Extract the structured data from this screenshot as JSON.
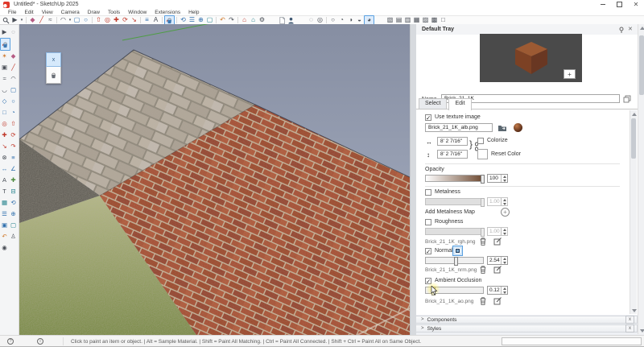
{
  "window": {
    "title": "Untitled* - SketchUp 2025"
  },
  "menu": {
    "items": [
      "File",
      "Edit",
      "View",
      "Camera",
      "Draw",
      "Tools",
      "Window",
      "Extensions",
      "Help"
    ]
  },
  "toolbar": {
    "main": [
      {
        "n": "search",
        "svg": "search"
      },
      {
        "n": "select",
        "g": "▶",
        "c": "c-dark"
      },
      {
        "n": "select-caret",
        "g": "▾",
        "c": "c-dark",
        "narrow": true
      },
      {
        "sep": true
      },
      {
        "n": "eraser",
        "g": "◆",
        "c": "c-pink"
      },
      {
        "n": "line",
        "g": "╱",
        "c": "c-red"
      },
      {
        "n": "freehand",
        "g": "≈",
        "c": "c-dark"
      },
      {
        "sep": true
      },
      {
        "n": "arc",
        "g": "◠",
        "c": "c-dark"
      },
      {
        "n": "arc-caret",
        "g": "▾",
        "c": "c-dark",
        "narrow": true
      },
      {
        "n": "rectangle",
        "g": "▢",
        "c": "c-blue"
      },
      {
        "n": "circle",
        "g": "○",
        "c": "c-blue"
      },
      {
        "sep": true
      },
      {
        "n": "push-pull",
        "g": "⇧",
        "c": "c-red"
      },
      {
        "n": "offset",
        "g": "◎",
        "c": "c-red"
      },
      {
        "n": "move",
        "g": "✚",
        "c": "c-red"
      },
      {
        "n": "rotate",
        "g": "⟳",
        "c": "c-red"
      },
      {
        "n": "scale",
        "g": "↘",
        "c": "c-red"
      },
      {
        "sep": true
      },
      {
        "n": "tape-measure",
        "g": "≡",
        "c": "c-blue"
      },
      {
        "n": "text",
        "g": "A",
        "c": "c-dark"
      },
      {
        "sep": true
      },
      {
        "n": "paint",
        "svg": "bucket",
        "sel": true
      },
      {
        "sep": true
      },
      {
        "n": "orbit",
        "g": "⟲",
        "c": "c-blue"
      },
      {
        "n": "pan",
        "g": "☰",
        "c": "c-blue"
      },
      {
        "n": "zoom",
        "g": "⊕",
        "c": "c-blue"
      },
      {
        "n": "zoom-extents",
        "g": "▢",
        "c": "c-teal"
      },
      {
        "sep": true
      },
      {
        "n": "undo",
        "g": "↶",
        "c": "c-orange"
      },
      {
        "n": "redo",
        "g": "↷",
        "c": "c-dark"
      },
      {
        "sep": true
      },
      {
        "n": "3d-warehouse",
        "g": "⌂",
        "c": "c-red"
      },
      {
        "n": "extension-warehouse",
        "g": "⌂",
        "c": "c-teal"
      },
      {
        "n": "extension-manager",
        "g": "⚙",
        "c": "c-dark"
      },
      {
        "gap": true
      },
      {
        "n": "new-document",
        "svg": "doc"
      },
      {
        "n": "sign-in",
        "svg": "person"
      },
      {
        "gap": true
      },
      {
        "n": "x-ray",
        "g": "◌",
        "c": "c-dark"
      },
      {
        "n": "back-edges",
        "g": "◎",
        "c": "c-dark"
      },
      {
        "sep": true
      },
      {
        "n": "wireframe",
        "g": "○",
        "c": "c-dark"
      },
      {
        "n": "hidden-line",
        "g": "◔",
        "c": "c-dark"
      },
      {
        "n": "shaded",
        "g": "◑",
        "c": "c-dark"
      },
      {
        "n": "monochrome",
        "g": "◒",
        "c": "c-dark"
      },
      {
        "n": "shaded-with-textures",
        "g": "◕",
        "c": "c-dark",
        "sel": true
      },
      {
        "gap": true
      },
      {
        "n": "iso-view",
        "g": "▧",
        "c": "c-dark"
      },
      {
        "n": "top-view",
        "g": "▤",
        "c": "c-dark"
      },
      {
        "n": "front-view",
        "g": "▥",
        "c": "c-dark"
      },
      {
        "n": "right-view",
        "g": "▦",
        "c": "c-dark"
      },
      {
        "n": "back-view",
        "g": "▨",
        "c": "c-dark"
      },
      {
        "n": "left-view",
        "g": "▩",
        "c": "c-dark"
      },
      {
        "n": "bottom-view",
        "g": "□",
        "c": "c-dark"
      }
    ]
  },
  "palette": {
    "items": [
      {
        "n": "select",
        "g": "▶",
        "c": "c-dark"
      },
      {
        "n": "lasso",
        "g": "◌",
        "c": "c-dark"
      },
      {
        "n": "paint",
        "svg": "bucket",
        "sel": true
      },
      {
        "n": "sample-material",
        "g": "✶",
        "c": "c-orange"
      },
      {
        "n": "eraser",
        "g": "◆",
        "c": "c-pink"
      },
      {
        "n": "stamp",
        "g": "▣",
        "c": "c-dark"
      },
      {
        "n": "line",
        "g": "╱",
        "c": "c-red"
      },
      {
        "n": "freehand",
        "g": "≈",
        "c": "c-dark"
      },
      {
        "n": "arc",
        "g": "◠",
        "c": "c-dark"
      },
      {
        "n": "two-point-arc",
        "g": "◡",
        "c": "c-dark"
      },
      {
        "n": "rectangle",
        "g": "▢",
        "c": "c-blue"
      },
      {
        "n": "rotated-rectangle",
        "g": "◇",
        "c": "c-blue"
      },
      {
        "n": "circle",
        "g": "○",
        "c": "c-blue"
      },
      {
        "n": "polygon",
        "g": "□",
        "c": "c-blue"
      },
      {
        "n": "pie",
        "g": "◔",
        "c": "c-blue"
      },
      {
        "n": "offset",
        "g": "◎",
        "c": "c-red"
      },
      {
        "n": "push-pull",
        "g": "⇧",
        "c": "c-red"
      },
      {
        "n": "move",
        "g": "✚",
        "c": "c-red"
      },
      {
        "n": "rotate",
        "g": "⟳",
        "c": "c-red"
      },
      {
        "n": "scale",
        "g": "↘",
        "c": "c-red"
      },
      {
        "n": "follow-me",
        "g": "↷",
        "c": "c-red"
      },
      {
        "n": "outer-shell",
        "g": "⊗",
        "c": "c-dark"
      },
      {
        "n": "tape-measure",
        "g": "≡",
        "c": "c-blue"
      },
      {
        "n": "dimension",
        "g": "↔",
        "c": "c-blue"
      },
      {
        "n": "protractor",
        "g": "∠",
        "c": "c-blue"
      },
      {
        "n": "text",
        "g": "A",
        "c": "c-dark"
      },
      {
        "n": "axes",
        "g": "✚",
        "c": "c-green"
      },
      {
        "n": "3d-text",
        "g": "T",
        "c": "c-dark"
      },
      {
        "n": "section-plane",
        "g": "⊟",
        "c": "c-teal"
      },
      {
        "n": "section-fill",
        "g": "▦",
        "c": "c-teal"
      },
      {
        "n": "orbit",
        "g": "⟲",
        "c": "c-blue"
      },
      {
        "n": "pan",
        "g": "☰",
        "c": "c-blue"
      },
      {
        "n": "zoom",
        "g": "⊕",
        "c": "c-blue"
      },
      {
        "n": "zoom-window",
        "g": "▣",
        "c": "c-blue"
      },
      {
        "n": "zoom-extents",
        "g": "▢",
        "c": "c-teal"
      },
      {
        "n": "previous-view",
        "g": "↶",
        "c": "c-orange"
      },
      {
        "n": "position-camera",
        "g": "♙",
        "c": "c-dark"
      },
      {
        "n": "look-around",
        "g": "◉",
        "c": "c-dark"
      }
    ]
  },
  "viewport": {
    "overlay_close": "x"
  },
  "tray": {
    "title": "Default Tray",
    "material": {
      "name_label": "Name",
      "name_value": "Brick_21_1K",
      "preview_plus": "+",
      "tabs": {
        "select": "Select",
        "edit": "Edit"
      },
      "edit": {
        "use_texture_label": "Use texture image",
        "texture_file": "Brick_21_1K_alb.png",
        "width_value": "8' 2 7/16\"",
        "height_value": "8' 2 7/16\"",
        "link_brace": "}",
        "colorize_label": "Colorize",
        "reset_color_label": "Reset Color",
        "opacity": {
          "label": "Opacity",
          "value": "100"
        },
        "metalness": {
          "label": "Metalness",
          "value": "1.00",
          "add_map_label": "Add Metalness Map"
        },
        "roughness": {
          "label": "Roughness",
          "value": "1.00",
          "file": "Brick_21_1K_rgh.png"
        },
        "normal": {
          "label": "Normal",
          "value": "2.54",
          "file": "Brick_21_1K_nrm.png"
        },
        "ambient_occlusion": {
          "label": "Ambient Occlusion",
          "value": "0.12",
          "file": "Brick_21_1K_ao.png"
        }
      }
    },
    "sections": {
      "components": "Components",
      "styles": "Styles"
    },
    "chevron": ">",
    "close_glyph": "x"
  },
  "statusbar": {
    "message": "Click to paint an item or object. | Alt = Sample Material. | Shift = Paint All Matching. | Ctrl = Paint All Connected. | Shift + Ctrl = Paint All on Same Object.",
    "help_glyph": "?",
    "info_glyph": "i",
    "measurements_value": ""
  },
  "colors": {
    "selection_accent": "#5aa0e0",
    "sky_top": "#868ea2",
    "sky_bottom": "#b3bbcb",
    "brick": "#a64a2e",
    "paver": "#b9afa2",
    "grass": "#8b9a50",
    "asphalt": "#5b5851",
    "preview_bg": "#4a4a4a"
  }
}
